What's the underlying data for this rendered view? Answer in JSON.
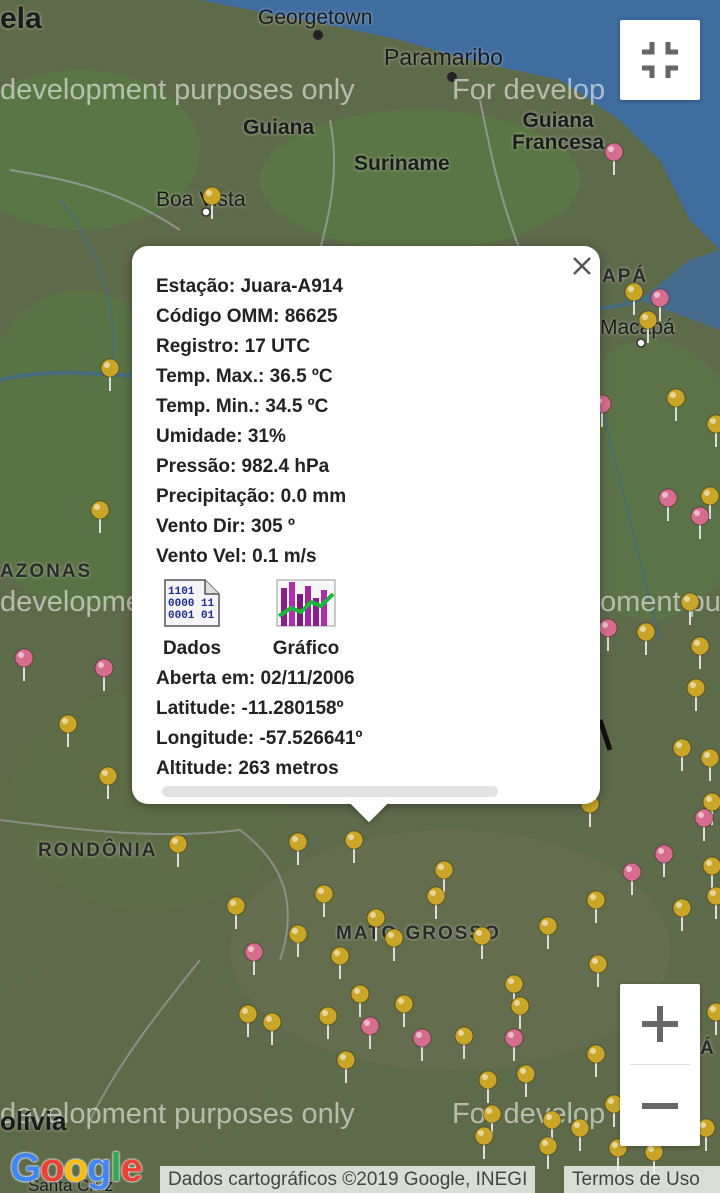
{
  "map": {
    "labels": {
      "georgetown": "Georgetown",
      "paramaribo": "Paramaribo",
      "guiana": "Guiana",
      "suriname": "Suriname",
      "guiana_francesa": "Guiana\nFrancesa",
      "boa_vista": "Boa Vista",
      "amapa": "APÁ",
      "macapa": "Macapá",
      "amazonas": "AZONAS",
      "rondonia": "RONDÔNIA",
      "mato_grosso": "MATO GROSSO",
      "bolivia": "olívia",
      "santa_cruz": "Santa Cruz",
      "venezuela": "ela",
      "edge_a": "Á"
    },
    "watermark": "For development purposes only",
    "watermark_cut": "development purposes only",
    "watermark_right": "For develop",
    "watermark_mid_right": "oment pu",
    "colors": {
      "land": "#5d6b4a",
      "ocean": "#3f6d9f",
      "gold_pin": "#c9a628",
      "pink_pin": "#d66d8f"
    }
  },
  "controls": {
    "fullscreen_icon": "exit-fullscreen-icon",
    "zoom_in_icon": "plus-icon",
    "zoom_out_icon": "minus-icon"
  },
  "branding": {
    "logo": "Google",
    "attribution": "Dados cartográficos ©2019 Google, INEGI",
    "terms": "Termos de Uso"
  },
  "popup": {
    "station": "Estação: Juara-A914",
    "omm": "Código OMM: 86625",
    "registro": "Registro: 17 UTC",
    "temp_max": "Temp. Max.: 36.5 ºC",
    "temp_min": "Temp. Min.: 34.5 ºC",
    "umidade": "Umidade: 31%",
    "pressao": "Pressão: 982.4 hPa",
    "precipitacao": "Precipitação: 0.0 mm",
    "vento_dir": "Vento Dir: 305 º",
    "vento_vel": "Vento Vel: 0.1 m/s",
    "dados_label": "Dados",
    "grafico_label": "Gráfico",
    "aberta": "Aberta em: 02/11/2006",
    "latitude": "Latitude: -11.280158º",
    "longitude": "Longitude: -57.526641º",
    "altitude": "Altitude: 263 metros"
  }
}
